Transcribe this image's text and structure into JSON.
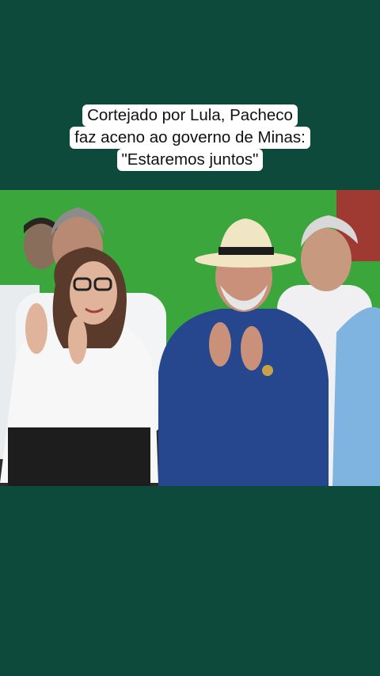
{
  "caption": {
    "line1": "Cortejado  por Lula, Pacheco",
    "line2": "faz aceno ao governo de Minas:",
    "line3": "\"Estaremos juntos\""
  },
  "colors": {
    "background": "#0d4a3b",
    "caption_bg": "#ffffff",
    "stage_green": "#38a33a"
  },
  "photo": {
    "subject": "people-applauding-at-event"
  }
}
